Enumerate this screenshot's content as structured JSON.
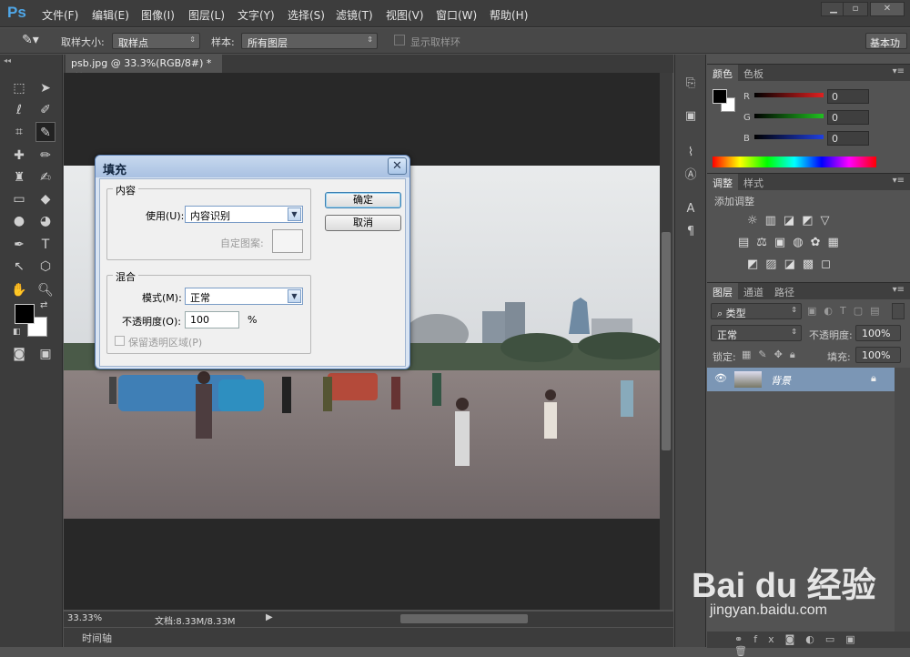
{
  "app": {
    "logo": "Ps"
  },
  "menu": [
    "文件(F)",
    "编辑(E)",
    "图像(I)",
    "图层(L)",
    "文字(Y)",
    "选择(S)",
    "滤镜(T)",
    "视图(V)",
    "窗口(W)",
    "帮助(H)"
  ],
  "window_controls": [
    "▁",
    "▫",
    "✕"
  ],
  "options": {
    "sample_size_label": "取样大小:",
    "sample_size_value": "取样点",
    "sample_label": "样本:",
    "sample_value": "所有图层",
    "show_ring_label": "显示取样环",
    "workspace": "基本功"
  },
  "document": {
    "tab": "psb.jpg @ 33.3%(RGB/8#) *",
    "tab_close": "×",
    "zoom": "33.33%",
    "doc_info": "文档:8.33M/8.33M"
  },
  "timeline": {
    "label": "时间轴"
  },
  "dialog": {
    "title": "填充",
    "close": "✕",
    "content_group": "内容",
    "use_label": "使用(U):",
    "use_value": "内容识别",
    "custom_pattern_label": "自定图案:",
    "blend_group": "混合",
    "mode_label": "模式(M):",
    "mode_value": "正常",
    "opacity_label": "不透明度(O):",
    "opacity_value": "100",
    "opacity_unit": "%",
    "preserve_label": "保留透明区域(P)",
    "ok": "确定",
    "cancel": "取消"
  },
  "color_panel": {
    "tabs": [
      "颜色",
      "色板"
    ],
    "channels": [
      {
        "name": "R",
        "value": "0",
        "color": "#d02020"
      },
      {
        "name": "G",
        "value": "0",
        "color": "#20b020"
      },
      {
        "name": "B",
        "value": "0",
        "color": "#2040d0"
      }
    ]
  },
  "adjust_panel": {
    "tabs": [
      "调整",
      "样式"
    ],
    "add_label": "添加调整"
  },
  "layers_panel": {
    "tabs": [
      "图层",
      "通道",
      "路径"
    ],
    "kind_label": "类型",
    "blend_mode": "正常",
    "opacity_label": "不透明度:",
    "opacity_value": "100%",
    "lock_label": "锁定:",
    "fill_label": "填充:",
    "fill_value": "100%",
    "layer_name": "背景"
  },
  "watermark": {
    "brand": "Bai du 经验",
    "url": "jingyan.baidu.com"
  }
}
